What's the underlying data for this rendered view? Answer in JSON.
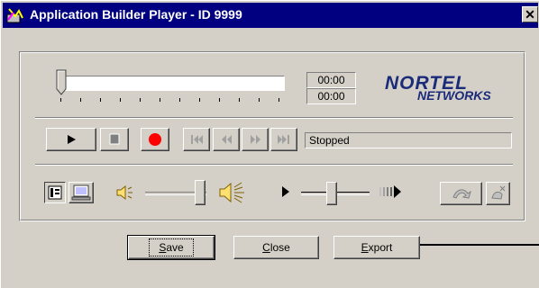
{
  "window": {
    "title": "Application Builder Player - ID 9999",
    "close_glyph": "✕"
  },
  "player": {
    "position_fraction": 0,
    "time_current": "00:00",
    "time_total": "00:00",
    "status": "Stopped"
  },
  "logo": {
    "line1": "NORTEL",
    "line2": "NETWORKS"
  },
  "transport": {
    "buttons": [
      "play-icon",
      "stop-icon",
      "record-icon",
      "skip-to-start-icon",
      "rewind-icon",
      "fast-forward-icon",
      "skip-to-end-icon"
    ]
  },
  "volume": {
    "level_fraction": 0.9
  },
  "speed": {
    "level_fraction": 0.45
  },
  "actions": {
    "save": {
      "pre": "",
      "key": "S",
      "post": "ave"
    },
    "close": {
      "pre": "",
      "key": "C",
      "post": "lose"
    },
    "export": {
      "pre": "",
      "key": "E",
      "post": "xport"
    }
  },
  "colors": {
    "titlebar": "#000080",
    "face": "#d4d0c8",
    "record": "#ff0000",
    "logo": "#1a2b7a"
  }
}
